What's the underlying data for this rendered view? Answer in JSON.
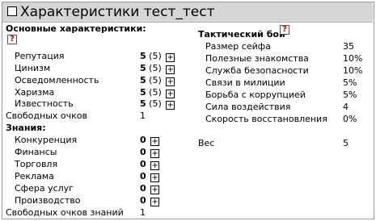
{
  "title": "Характеристики тест_тест",
  "main": {
    "header": "Основные характеристики:",
    "rows": [
      {
        "label": "Репутация",
        "value": "5",
        "paren": "(5)",
        "plus": "+"
      },
      {
        "label": "Цинизм",
        "value": "5",
        "paren": "(5)",
        "plus": "+"
      },
      {
        "label": "Осведомленность",
        "value": "5",
        "paren": "(5)",
        "plus": "+"
      },
      {
        "label": "Харизма",
        "value": "5",
        "paren": "(5)",
        "plus": "+"
      },
      {
        "label": "Известность",
        "value": "5",
        "paren": "(5)",
        "plus": "+"
      }
    ],
    "free_label": "Свободных очков",
    "free_value": "1"
  },
  "knowledge": {
    "header": "Знания:",
    "rows": [
      {
        "label": "Конкуренция",
        "value": "0",
        "plus": "+"
      },
      {
        "label": "Финансы",
        "value": "0",
        "plus": "+"
      },
      {
        "label": "Торговля",
        "value": "0",
        "plus": "+"
      },
      {
        "label": "Реклама",
        "value": "0",
        "plus": "+"
      },
      {
        "label": "Сфера услуг",
        "value": "0",
        "plus": "+"
      },
      {
        "label": "Производство",
        "value": "0",
        "plus": "+"
      }
    ],
    "free_label": "Свободных очков знаний",
    "free_value": "1"
  },
  "tactical": {
    "header": "Тактический бой",
    "rows": [
      {
        "label": "Размер сейфа",
        "value": "35"
      },
      {
        "label": "Полезные знакомства",
        "value": "10%"
      },
      {
        "label": "Служба безопасности",
        "value": "10%"
      },
      {
        "label": "Связи в милиции",
        "value": "5%"
      },
      {
        "label": "Борьба с коррупцией",
        "value": "5%"
      },
      {
        "label": "Сила воздействия",
        "value": "4"
      },
      {
        "label": "Скорость восстановления",
        "value": "0%"
      }
    ],
    "weight_label": "Вес",
    "weight_value": "5"
  },
  "help_icon": "?",
  "icons": {
    "help": "question-icon",
    "plus": "plus-box-icon",
    "checkbox": "checkbox-icon"
  }
}
